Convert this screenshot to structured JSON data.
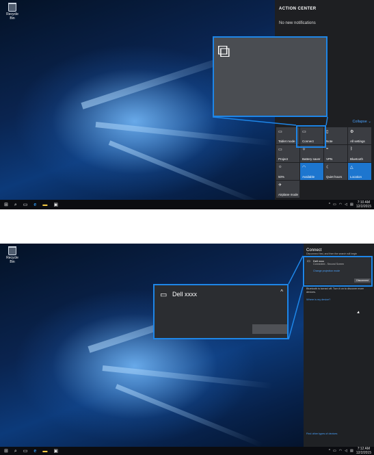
{
  "desktop": {
    "recycle_bin_label": "Recycle Bin"
  },
  "shot1": {
    "action_center": {
      "title": "ACTION CENTER",
      "no_notifications": "No new notifications",
      "collapse": "Collapse",
      "tiles": [
        {
          "label": "Tablet mode",
          "icon": "tablet-icon",
          "glyph": "▭",
          "active": false
        },
        {
          "label": "Connect",
          "icon": "connect-icon",
          "glyph": "▭",
          "active": false
        },
        {
          "label": "Note",
          "icon": "note-icon",
          "glyph": "▯",
          "active": false
        },
        {
          "label": "All settings",
          "icon": "gear-icon",
          "glyph": "⚙",
          "active": false
        },
        {
          "label": "Project",
          "icon": "project-icon",
          "glyph": "▭",
          "active": false
        },
        {
          "label": "Battery saver",
          "icon": "battery-icon",
          "glyph": "✧",
          "active": false
        },
        {
          "label": "VPN",
          "icon": "vpn-icon",
          "glyph": "≈",
          "active": false
        },
        {
          "label": "Bluetooth",
          "icon": "bluetooth-icon",
          "glyph": "ᛒ",
          "active": false
        },
        {
          "label": "50%",
          "icon": "brightness-icon",
          "glyph": "☼",
          "active": false
        },
        {
          "label": "Available",
          "icon": "wifi-icon",
          "glyph": "◠",
          "active": true
        },
        {
          "label": "Quiet hours",
          "icon": "moon-icon",
          "glyph": "☾",
          "active": false
        },
        {
          "label": "Location",
          "icon": "location-icon",
          "glyph": "△",
          "active": true
        },
        {
          "label": "Airplane mode",
          "icon": "airplane-icon",
          "glyph": "✈",
          "active": false
        }
      ]
    },
    "clock": {
      "time": "7:10 AM",
      "date": "12/2/2015"
    }
  },
  "shot2": {
    "connect": {
      "title": "Connect",
      "subtitle": "Disconnect first, and then the search will begin",
      "device_name": "Dell xxxx",
      "device_status": "Connected - Second Screen",
      "change_projection": "Change projection mode",
      "disconnect": "Disconnect",
      "bluetooth_msg": "Bluetooth is turned off. Turn it on to discover more devices.",
      "where_link": "Where is my device?",
      "other_link": "Find other types of devices"
    },
    "zoom": {
      "device_name": "Dell xxxx"
    },
    "clock": {
      "time": "7:12 AM",
      "date": "12/2/2015"
    }
  },
  "colors": {
    "accent": "#1e86e8",
    "tile_active": "#1d76cf",
    "panel": "#1e1f22"
  }
}
